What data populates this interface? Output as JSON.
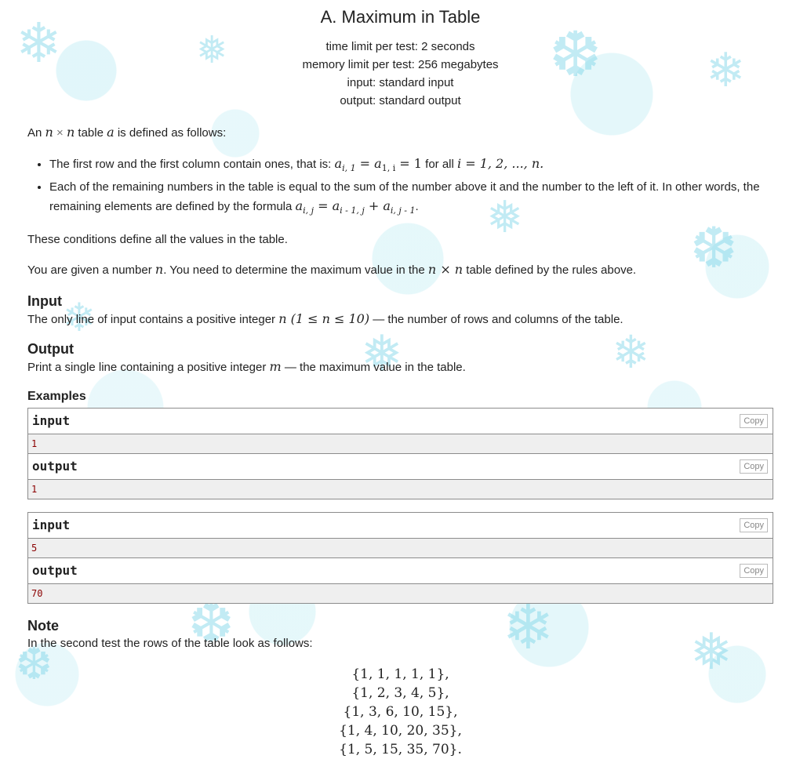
{
  "problem": {
    "title": "A. Maximum in Table",
    "time_limit": "time limit per test: 2 seconds",
    "memory_limit": "memory limit per test: 256 megabytes",
    "input_file": "input: standard input",
    "output_file": "output: standard output"
  },
  "statement": {
    "intro_pre": "An ",
    "intro_n1": "n",
    "intro_times": " × ",
    "intro_n2": "n",
    "intro_mid": " table ",
    "intro_a": "a",
    "intro_post": " is defined as follows:",
    "bullet1_text": "The first row and the first column contain ones, that is: ",
    "bullet1_formula": "a",
    "bullet1_sub1": "i, 1",
    "bullet1_eq1": " = a",
    "bullet1_sub2": "1, i",
    "bullet1_eq2": " = 1",
    "bullet1_forall": " for all ",
    "bullet1_range": "i = 1, 2, ..., n.",
    "bullet2_text": "Each of the remaining numbers in the table is equal to the sum of the number above it and the number to the left of it. In other words, the remaining elements are defined by the formula ",
    "bullet2_a1": "a",
    "bullet2_s1": "i, j",
    "bullet2_eq": " = a",
    "bullet2_s2": "i - 1, j",
    "bullet2_plus": " + a",
    "bullet2_s3": "i, j - 1",
    "bullet2_end": ".",
    "conditions": "These conditions define all the values in the table.",
    "given_pre": "You are given a number ",
    "given_n": "n",
    "given_mid": ". You need to determine the maximum value in the ",
    "given_nxn": "n × n",
    "given_post": " table defined by the rules above."
  },
  "input_section": {
    "title": "Input",
    "text_pre": "The only line of input contains a positive integer ",
    "text_math": "n (1 ≤ n ≤ 10)",
    "text_post": " — the number of rows and columns of the table."
  },
  "output_section": {
    "title": "Output",
    "text_pre": "Print a single line containing a positive integer ",
    "text_math": "m",
    "text_post": " — the maximum value in the table."
  },
  "examples": {
    "title": "Examples",
    "copy_label": "Copy",
    "input_label": "input",
    "output_label": "output",
    "tests": [
      {
        "input": "1",
        "output": "1"
      },
      {
        "input": "5",
        "output": "70"
      }
    ]
  },
  "note": {
    "title": "Note",
    "text": "In the second test the rows of the table look as follows:",
    "rows": [
      "{1, 1, 1, 1, 1},",
      "{1, 2, 3, 4, 5},",
      "{1, 3, 6, 10, 15},",
      "{1, 4, 10, 20, 35},",
      "{1, 5, 15, 35, 70}."
    ]
  },
  "decor": {
    "snowflake_icon": "snowflake-icon",
    "snow_color": "#78d2e6"
  }
}
